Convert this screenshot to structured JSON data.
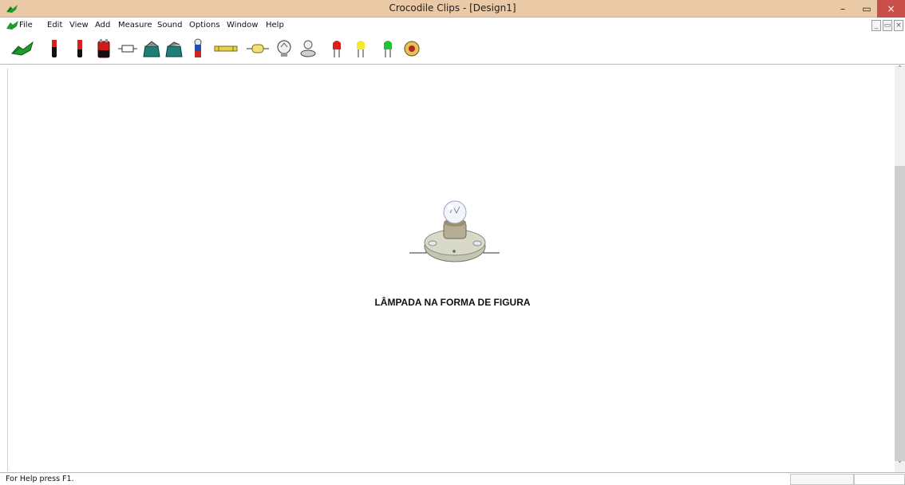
{
  "window": {
    "title": "Crocodile Clips - [Design1]",
    "controls": {
      "minimize": "–",
      "maximize": "▭",
      "close": "×"
    }
  },
  "menu": {
    "items": [
      "File",
      "Edit",
      "View",
      "Add",
      "Measure",
      "Sound",
      "Options",
      "Window",
      "Help"
    ],
    "mdi_controls": [
      "_",
      "▭",
      "×"
    ]
  },
  "toolbar": {
    "tools": [
      "crocodile-icon",
      "battery-cell-icon",
      "battery-icon",
      "battery-pack-icon",
      "resistor-icon",
      "switch-icon",
      "switch-2-icon",
      "fuse-icon",
      "variable-resistor-icon",
      "capacitor-icon",
      "bulb-icon",
      "bulb-holder-icon",
      "red-led-icon",
      "yellow-led-icon",
      "green-led-icon",
      "buzzer-icon"
    ]
  },
  "canvas": {
    "component": "lamp-in-holder",
    "caption": "LÂMPADA NA FORMA DE FIGURA"
  },
  "status": {
    "help_text": "For Help press F1."
  },
  "colors": {
    "titlebar": "#e9c9a6",
    "close_button": "#c9504a",
    "crocodile_green": "#1f9a2e"
  }
}
